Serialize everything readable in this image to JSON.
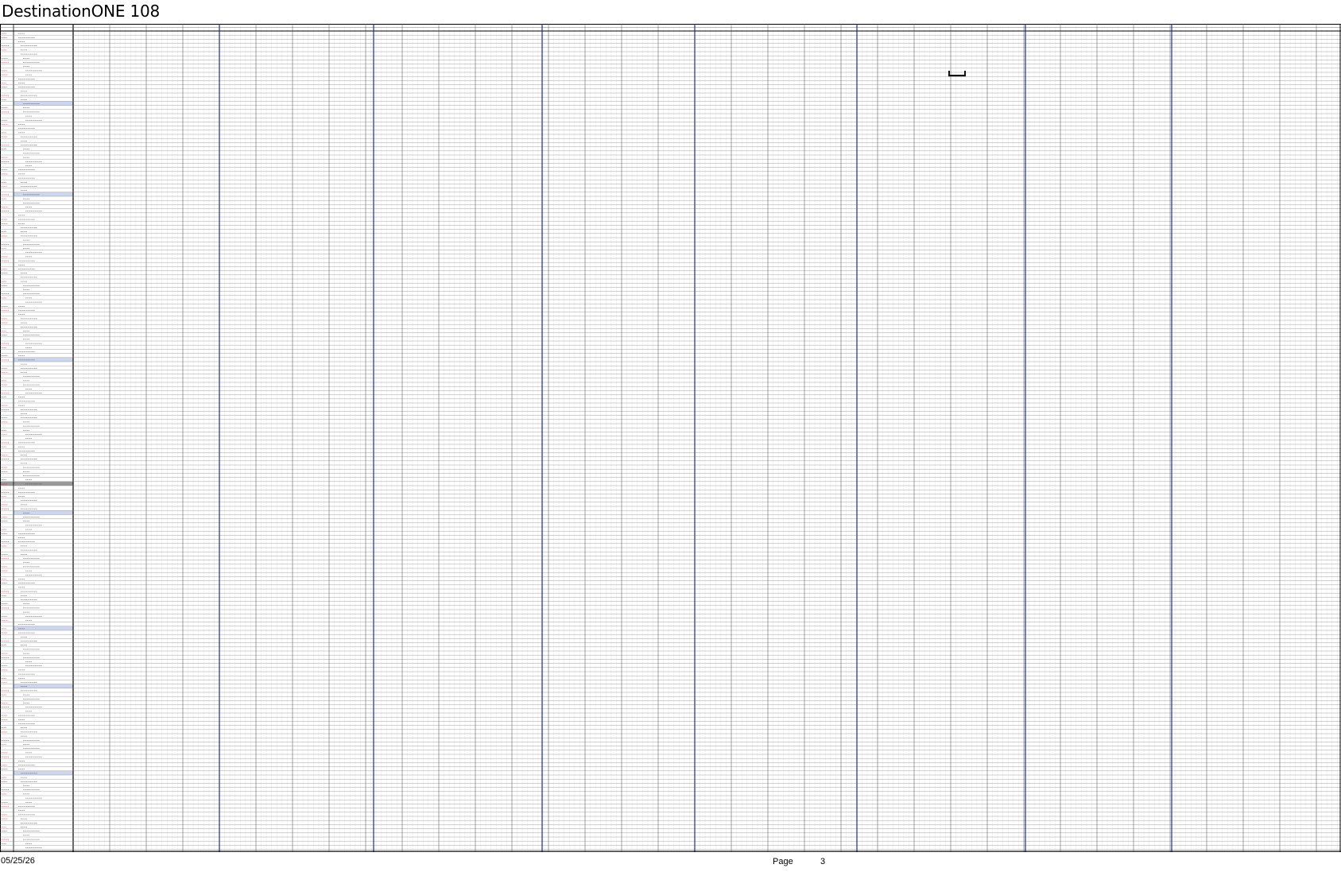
{
  "document": {
    "title": "DestinationONE 108",
    "footer": {
      "date": "05/25/26",
      "page_label": "Page",
      "page_number": "3"
    }
  },
  "table": {
    "left_headers": [
      "",
      ""
    ],
    "group_band_rows": [
      17,
      39,
      79,
      116,
      144,
      158,
      179
    ],
    "gray_band_rows": [
      109
    ],
    "milestone": {
      "row": 10,
      "left_label": "",
      "right_label": ""
    }
  },
  "colors": {
    "grid_line": "#8a8a8a",
    "major_divider": "#1a2f8f",
    "group_band": "#cdd6ee",
    "gray_band": "#9a9a9a",
    "accent_text": "#c0282d",
    "milestone_bar": "#111111"
  }
}
